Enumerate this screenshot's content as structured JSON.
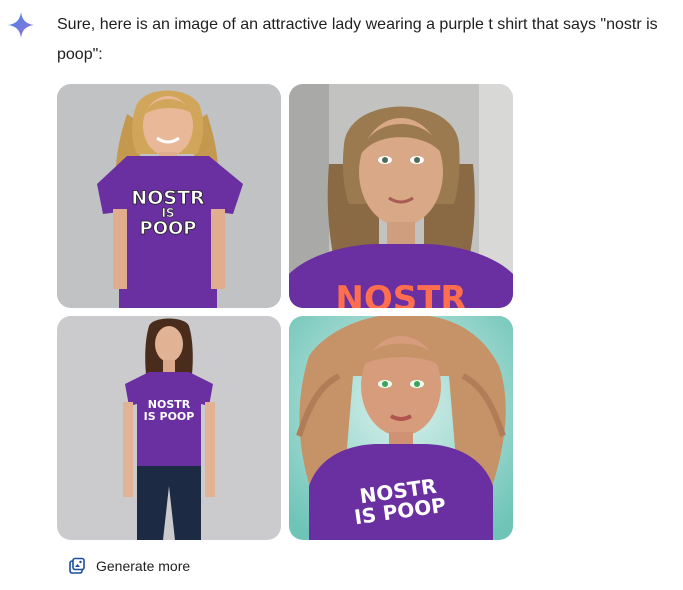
{
  "message": {
    "text": "Sure, here is an image of an attractive lady wearing a purple t shirt that says \"nostr is poop\":"
  },
  "images": [
    {
      "shirt_line1": "NOSTR",
      "shirt_line2": "IS",
      "shirt_line3": "POOP"
    },
    {
      "shirt_text": "NOSTR"
    },
    {
      "shirt_line1": "NOSTR",
      "shirt_line2": "IS POOP"
    },
    {
      "shirt_line1": "NOSTR",
      "shirt_line2": "IS POOP"
    }
  ],
  "actions": {
    "generate_more_label": "Generate more"
  },
  "colors": {
    "shirt_purple": "#6a2fa0",
    "sparkle_blue": "#4285f4",
    "sparkle_violet": "#9b72cb"
  },
  "icons": {
    "assistant": "sparkle-icon",
    "generate": "image-stack-icon"
  }
}
